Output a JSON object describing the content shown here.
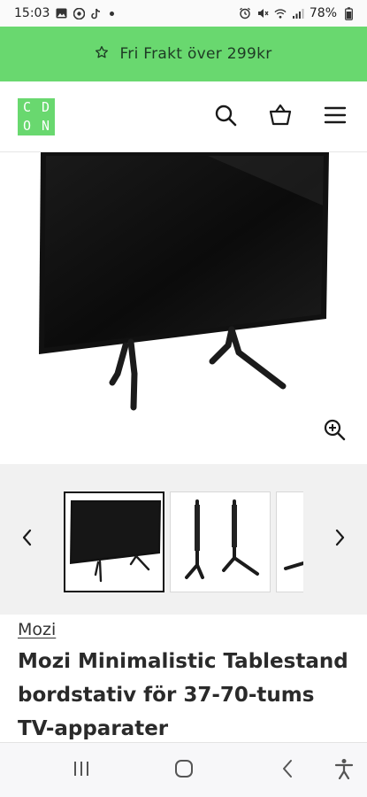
{
  "status_bar": {
    "time": "15:03",
    "battery": "78%",
    "icons_left": [
      "image-icon",
      "chrome-icon",
      "tiktok-icon",
      "dot-icon"
    ],
    "icons_right": [
      "alarm-icon",
      "mute-icon",
      "wifi-icon",
      "signal-icon"
    ]
  },
  "promo": {
    "icon": "star-outline-icon",
    "text": "Fri Frakt över 299kr",
    "background": "#69d86f"
  },
  "header": {
    "logo_letters": [
      "C",
      "D",
      "O",
      "N"
    ],
    "actions": [
      "search-icon",
      "basket-icon",
      "menu-icon"
    ]
  },
  "gallery": {
    "zoom_icon": "zoom-in-icon",
    "prev_icon": "chevron-left-icon",
    "next_icon": "chevron-right-icon",
    "selected_thumbnail": 1
  },
  "product": {
    "brand": "Mozi",
    "title": "Mozi Minimalistic Tablestand bordstativ för 37-70-tums TV-apparater"
  },
  "navbar": {
    "icons": [
      "recent-apps-icon",
      "home-icon",
      "back-icon",
      "accessibility-icon"
    ]
  }
}
